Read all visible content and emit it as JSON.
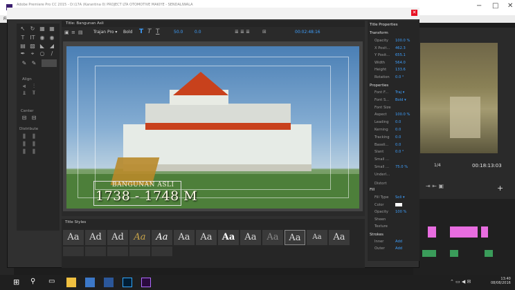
{
  "window": {
    "title": "Adobe Premiere Pro CC 2015 - D:\\17A (Karantina 0) PROJECT LTA OTOMOTIVE MAKIYE - SENDALIWALA",
    "min": "−",
    "max": "□",
    "close": "✕"
  },
  "menu": {
    "first": "File"
  },
  "dialog": {
    "tab": "Title: Bangunan Asli",
    "close": "✕"
  },
  "toolbar": {
    "font": "Trajan Pro ▾",
    "style": "Bold",
    "size": "50.0",
    "kern": "0.0",
    "timecode": "00:02:48:16"
  },
  "tools": {
    "align_label": "Align",
    "center_label": "Center",
    "distribute_label": "Distribute"
  },
  "title_text": {
    "line1": "BANGUNAN ASLI",
    "line2": "1738 - 1748 M"
  },
  "styles": {
    "tab": "Title Styles",
    "swatches": [
      "Aa",
      "Ad",
      "Ad",
      "Aa",
      "Aa",
      "Aa",
      "Aa",
      "Aa",
      "Aa",
      "Aa",
      "Aa",
      "Aa",
      "Aa"
    ]
  },
  "properties": {
    "tab": "Title Properties",
    "transform_head": "Transform",
    "transform": [
      [
        "Opacity",
        "100.0 %"
      ],
      [
        "X Posit...",
        "462.3"
      ],
      [
        "Y Posit...",
        "655.1"
      ],
      [
        "Width",
        "564.0"
      ],
      [
        "Height",
        "133.6"
      ],
      [
        "Rotation",
        "0.0 °"
      ]
    ],
    "properties_head": "Properties",
    "props": [
      [
        "Font F...",
        "Traj ▾"
      ],
      [
        "Font S...",
        "Bold ▾"
      ],
      [
        "Font Size",
        ""
      ],
      [
        "Aspect",
        "100.0 %"
      ],
      [
        "Leading",
        "0.0"
      ],
      [
        "Kerning",
        "0.0"
      ],
      [
        "Tracking",
        "0.0"
      ],
      [
        "Baseli...",
        "0.0"
      ],
      [
        "Slant",
        "0.0 °"
      ],
      [
        "Small ...",
        ""
      ],
      [
        "Small ...",
        "75.0 %"
      ],
      [
        "Underl...",
        ""
      ]
    ],
    "distort": "Distort",
    "fill_head": "Fill",
    "fill": [
      [
        "Fill Type",
        "Soli ▾"
      ],
      [
        "Color",
        ""
      ],
      [
        "Opacity",
        "100 %"
      ],
      [
        "Sheen",
        ""
      ],
      [
        "Texture",
        ""
      ]
    ],
    "strokes_head": "Strokes",
    "strokes": [
      [
        "Inner",
        "Add"
      ],
      [
        "Outer",
        "Add"
      ]
    ]
  },
  "monitor": {
    "fraction": "1/4",
    "timecode": "00:18:13:03"
  },
  "taskbar": {
    "time": "13:40",
    "date": "08/08/2016",
    "start": "⊞",
    "search": "⚲",
    "task": "▭"
  }
}
